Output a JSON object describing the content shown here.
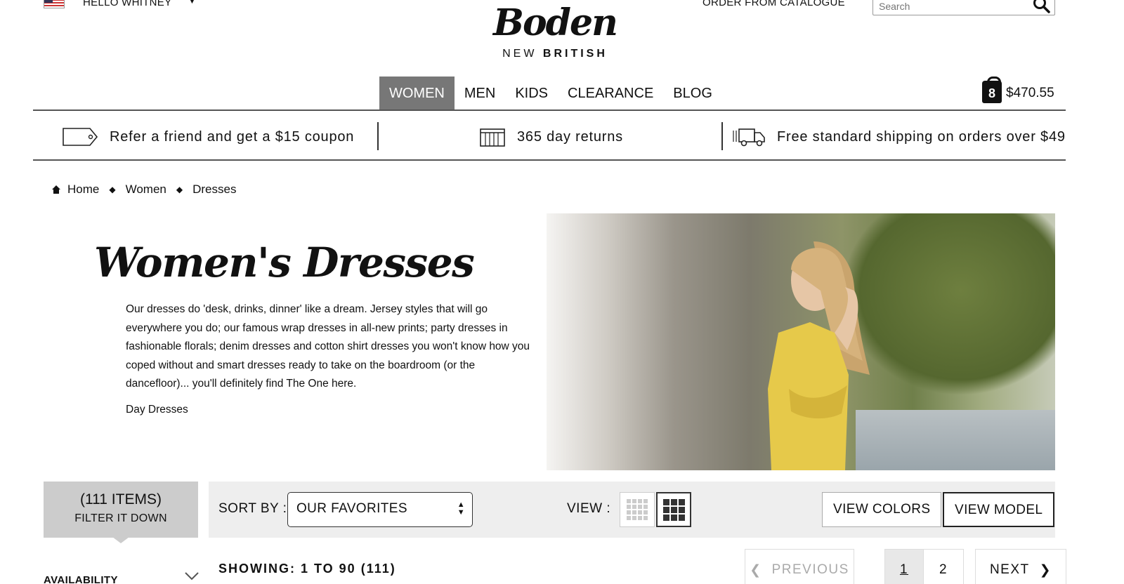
{
  "header": {
    "greeting": "HELLO WHITNEY",
    "catalogue_link": "ORDER FROM CATALOGUE",
    "search_placeholder": "Search",
    "logo_script": "Boden",
    "logo_sub_left": "NEW",
    "logo_sub_right": "BRITISH",
    "bag_count": "8",
    "bag_total": "$470.55"
  },
  "nav": {
    "items": [
      "WOMEN",
      "MEN",
      "KIDS",
      "CLEARANCE",
      "BLOG"
    ],
    "active": "WOMEN"
  },
  "promos": [
    {
      "icon": "tag-icon",
      "text": "Refer a friend and get a $15 coupon"
    },
    {
      "icon": "calendar-icon",
      "text": "365 day returns"
    },
    {
      "icon": "truck-icon",
      "text": "Free standard shipping on orders over $49"
    }
  ],
  "breadcrumb": [
    "Home",
    "Women",
    "Dresses"
  ],
  "hero": {
    "title": "Women's Dresses",
    "description": "Our dresses do 'desk, drinks, dinner' like a dream. Jersey styles that will go everywhere you do; our famous wrap dresses in all-new prints; party dresses in fashionable florals; denim dresses and cotton shirt dresses you won't know how you coped without and smart dresses ready to take on the boardroom (or the dancefloor)... you'll definitely find The One here.",
    "sub_link": "Day Dresses"
  },
  "toolbar": {
    "items_count": "(111 ITEMS)",
    "filter_label": "FILTER IT DOWN",
    "sort_label": "SORT BY :",
    "sort_value": "OUR FAVORITES",
    "view_label": "VIEW :",
    "view_colors": "VIEW COLORS",
    "view_model": "VIEW MODEL"
  },
  "filters": {
    "availability": "AVAILABILITY"
  },
  "results": {
    "showing": "SHOWING: 1 TO 90 (111)"
  },
  "pagination": {
    "previous": "PREVIOUS",
    "pages": [
      "1",
      "2"
    ],
    "current": "1",
    "next": "NEXT"
  },
  "colors": {
    "nav_active": "#777777",
    "filter_bg": "#cccccc",
    "toolbar_bg": "#eeeeee"
  }
}
